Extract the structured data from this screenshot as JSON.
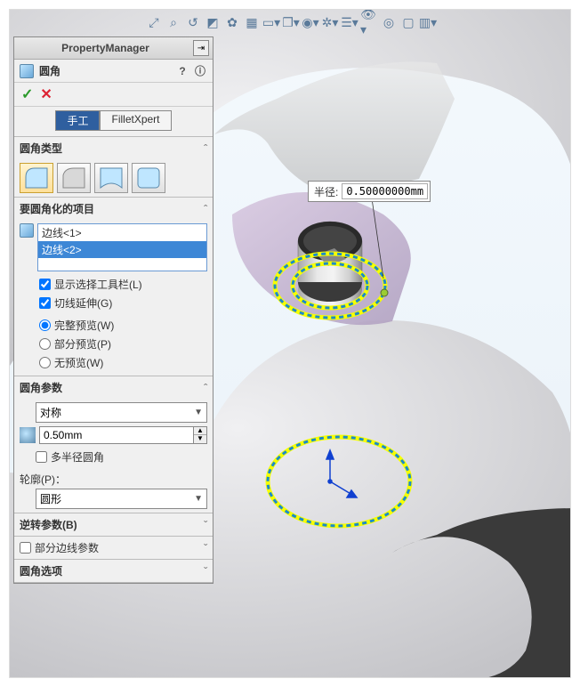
{
  "pm": {
    "title": "PropertyManager",
    "feature_name": "圆角",
    "tab_manual": "手工",
    "tab_expert": "FilletXpert",
    "sec_type": "圆角类型",
    "sec_items": "要圆角化的项目",
    "sel_edge1": "边线<1>",
    "sel_edge2": "边线<2>",
    "chk_show_toolbar": "显示选择工具栏(L)",
    "chk_tangent": "切线延伸(G)",
    "rad_full": "完整预览(W)",
    "rad_partial": "部分预览(P)",
    "rad_none": "无预览(W)",
    "sec_params": "圆角参数",
    "dd_sym": "对称",
    "radius_value": "0.50mm",
    "chk_multi": "多半径圆角",
    "lbl_profile": "轮廓(P)：",
    "dd_profile": "圆形",
    "sec_reverse": "逆转参数(B)",
    "sec_partial_edge": "部分边线参数",
    "sec_options": "圆角选项"
  },
  "callout": {
    "label": "半径:",
    "value": "0.50000000mm"
  }
}
